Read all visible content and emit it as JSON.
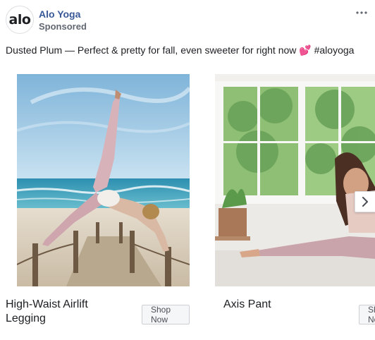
{
  "post": {
    "page_name": "Alo Yoga",
    "logo_text": "alo",
    "sponsored_label": "Sponsored",
    "more_icon": "ellipsis-icon",
    "caption": "Dusted Plum — Perfect & pretty for fall, even sweeter for right now ",
    "caption_emoji": "💕",
    "caption_hashtag": " #aloyoga"
  },
  "carousel": {
    "cards": [
      {
        "title": "High-Waist Airlift Legging",
        "button_label": "Shop Now",
        "image_icon": "beach-yoga-photo"
      },
      {
        "title": "Axis Pant",
        "button_label": "Shop Now",
        "image_icon": "studio-yoga-photo"
      }
    ],
    "next_icon": "chevron-right-icon"
  },
  "colors": {
    "page_name": "#385898",
    "sponsored": "#616770",
    "button_bg": "#f5f6f7"
  }
}
